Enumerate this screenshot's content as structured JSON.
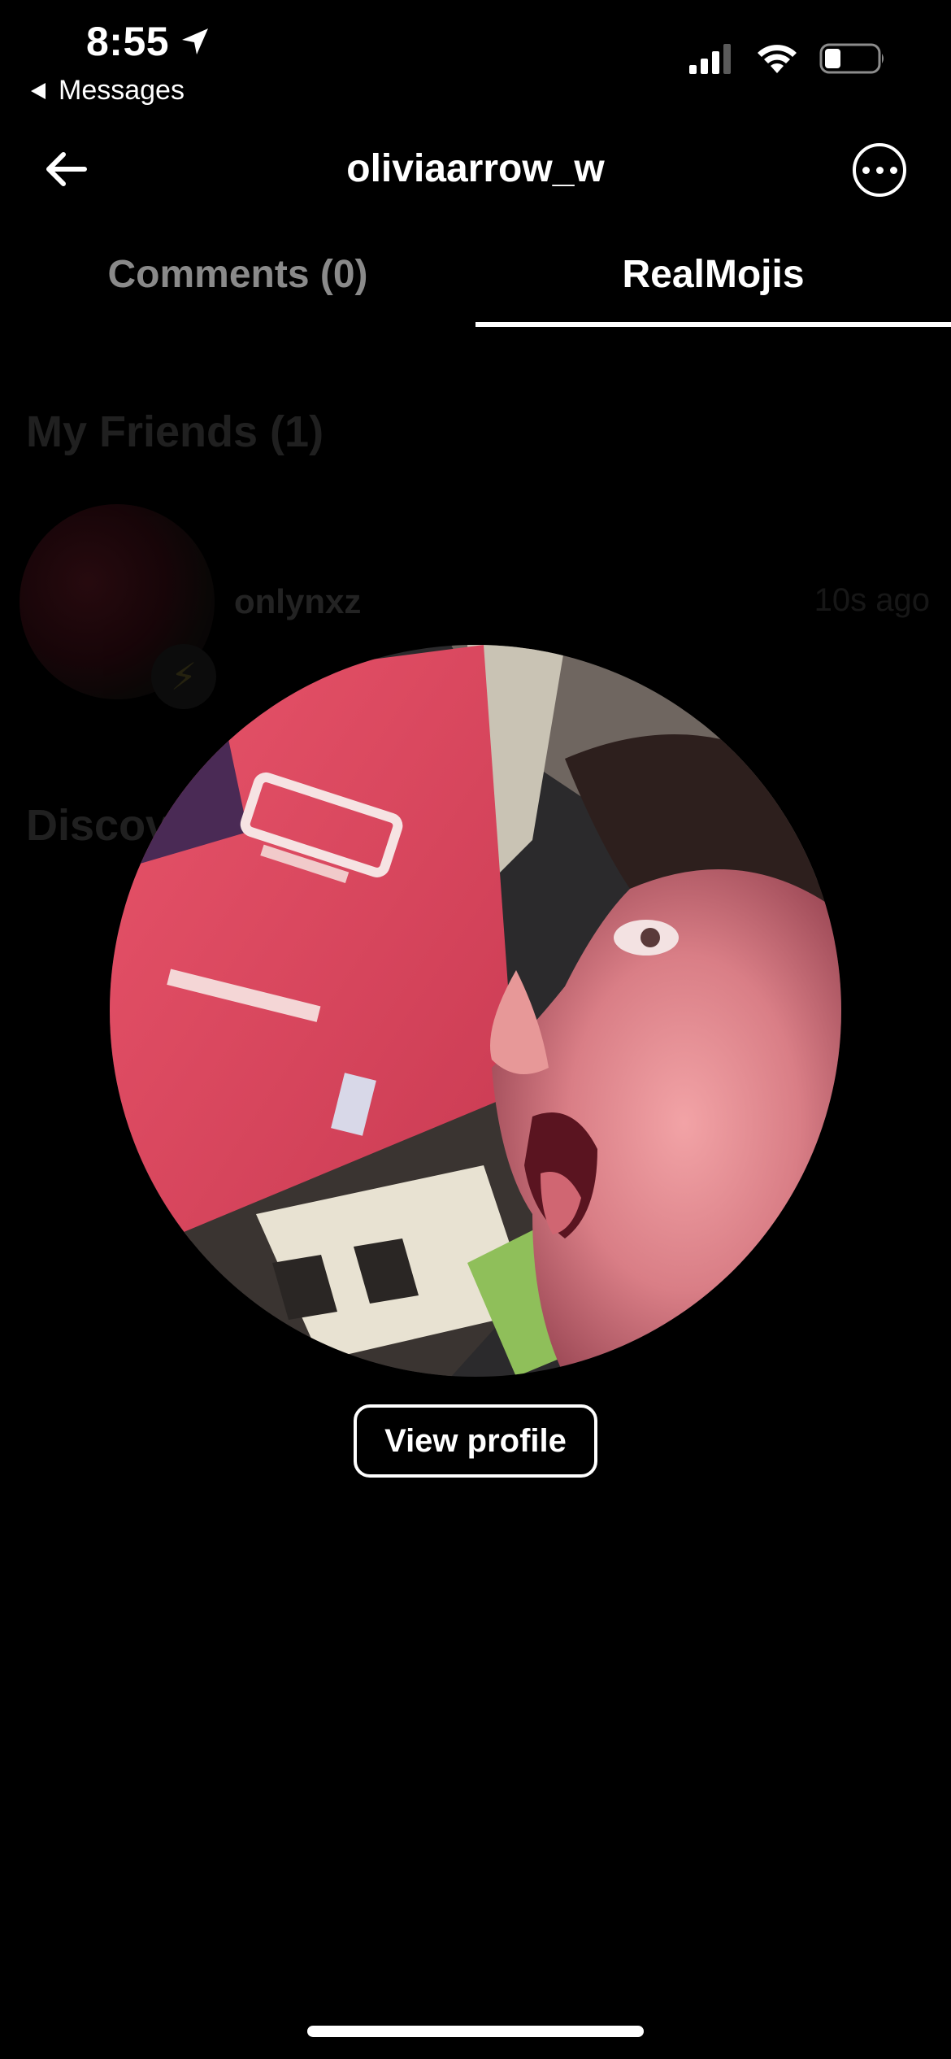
{
  "status_bar": {
    "time": "8:55",
    "back_label": "Messages",
    "battery_level": 0.3
  },
  "header": {
    "title": "oliviaarrow_w"
  },
  "tabs": [
    {
      "label": "Comments (0)",
      "active": false
    },
    {
      "label": "RealMojis",
      "active": true
    }
  ],
  "background_list": {
    "friends_title": "My Friends (1)",
    "friend": {
      "name": "onlynxz",
      "time": "10s ago"
    },
    "discover_title": "Discov"
  },
  "actions": {
    "view_profile_label": "View profile"
  },
  "colors": {
    "background": "#000000",
    "text": "#ffffff",
    "inactive_tab": "#8a8a8a"
  }
}
